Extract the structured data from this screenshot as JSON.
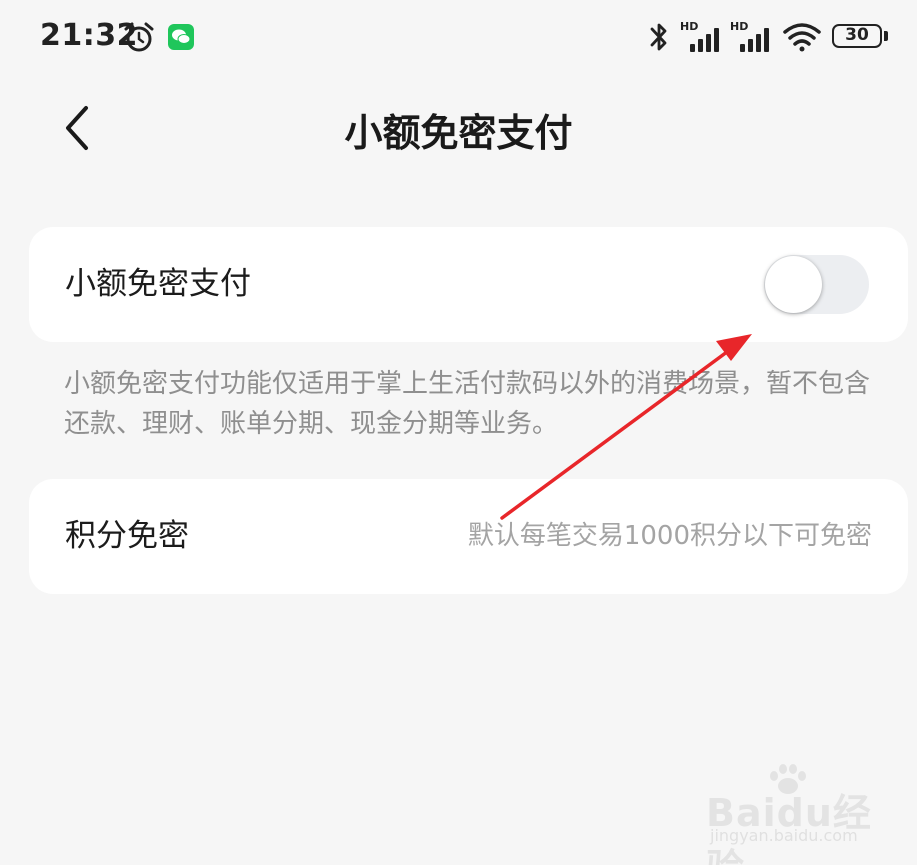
{
  "status_bar": {
    "time": "21:32",
    "battery": "30",
    "signal_label_1": "HD",
    "signal_label_2": "HD",
    "icons": [
      "alarm-icon",
      "wechat-icon",
      "bluetooth-icon",
      "signal-icon",
      "signal-icon",
      "wifi-icon",
      "battery-icon"
    ]
  },
  "header": {
    "title": "小额免密支付",
    "back_icon": "chevron-left-icon"
  },
  "settings": {
    "small_payment": {
      "label": "小额免密支付",
      "enabled": false
    },
    "description": "小额免密支付功能仅适用于掌上生活付款码以外的消费场景，暂不包含还款、理财、账单分期、现金分期等业务。",
    "points_free": {
      "label": "积分免密",
      "value": "默认每笔交易1000积分以下可免密"
    }
  },
  "watermark": {
    "brand": "Baidu经验",
    "site": "jingyan.baidu.com"
  },
  "colors": {
    "background": "#f6f6f6",
    "card": "#ffffff",
    "toggle_off": "#eceef1",
    "annotation_arrow": "#e8262a",
    "wechat_green": "#1fc65b"
  }
}
